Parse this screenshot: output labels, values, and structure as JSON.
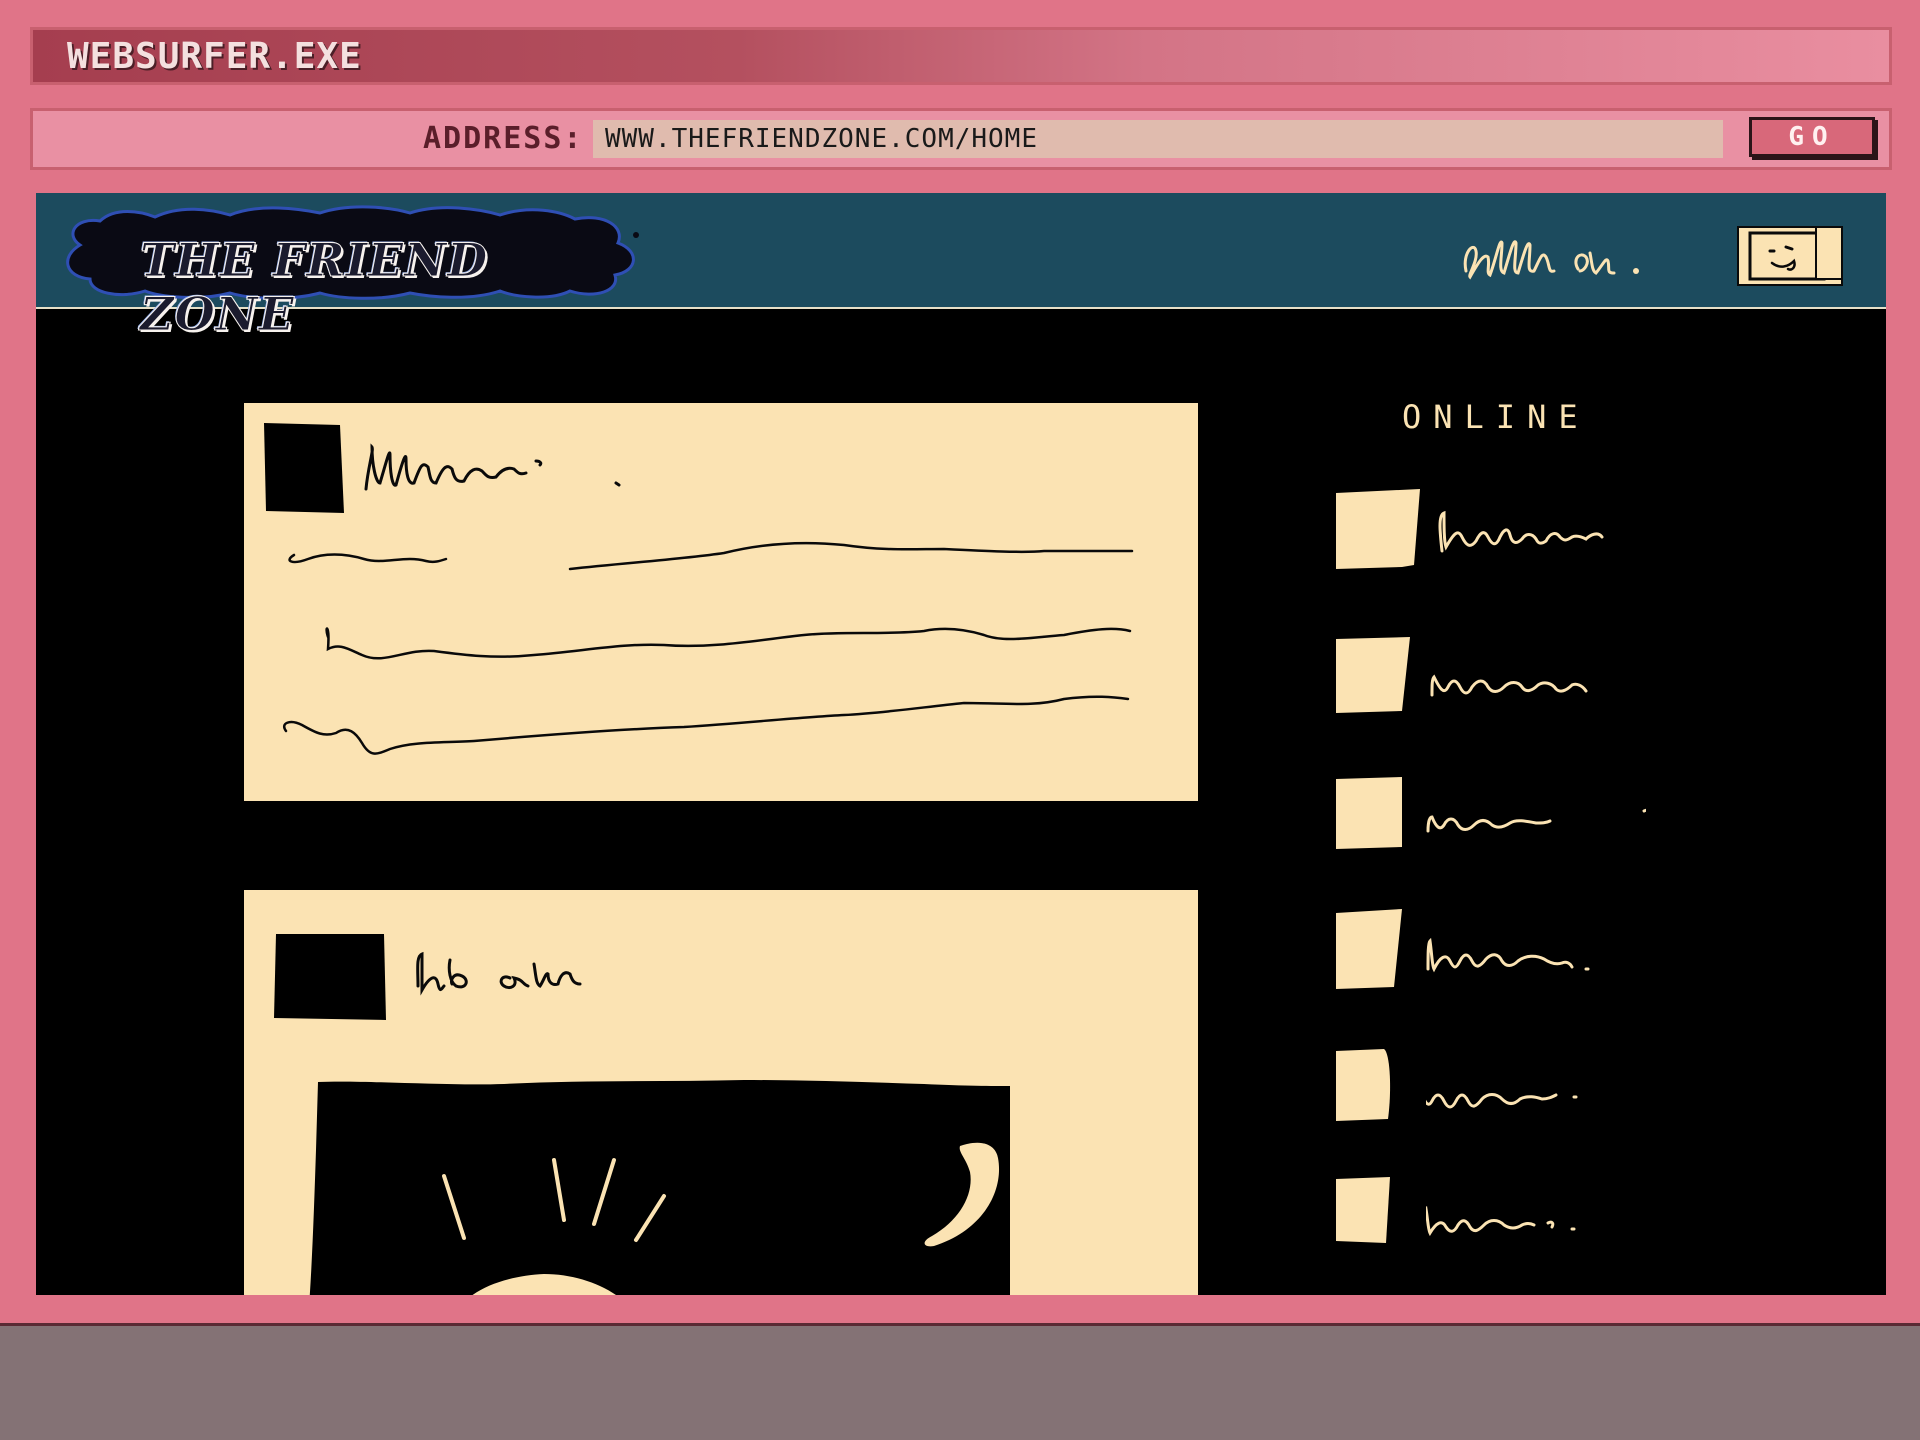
{
  "window": {
    "title": "WEBSURFER.EXE",
    "frame_color": "#e07488"
  },
  "addressbar": {
    "label": "ADDRESS:",
    "url": "WWW.THEFRIENDZONE.COM/HOME",
    "go_label": "GO"
  },
  "site": {
    "logo_text": "THE FRIEND ZONE",
    "header_color": "#1c4b5e",
    "card_color": "#fbe3b3"
  },
  "sidebar": {
    "online_label": "ONLINE",
    "friends_count": 6
  }
}
